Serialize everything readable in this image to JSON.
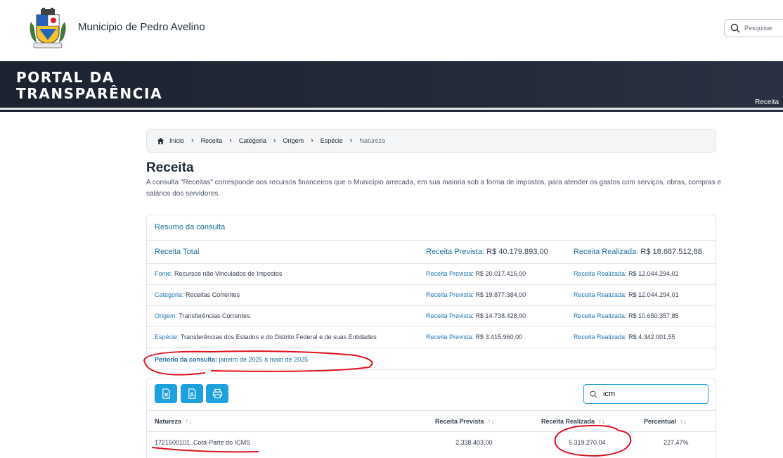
{
  "header": {
    "municipality": "Municipio de Pedro Avelino",
    "search_placeholder": "Pesquisar"
  },
  "banner": {
    "title_line1": "PORTAL DA",
    "title_line2": "TRANSPARÊNCIA",
    "active_tab": "Receita"
  },
  "breadcrumb": {
    "items": [
      "Inicio",
      "Receita",
      "Categoria",
      "Origem",
      "Espécie",
      "Natureza"
    ]
  },
  "page": {
    "title": "Receita",
    "description": "A consulta \"Receitas\" corresponde aos recursos financeiros que o Município arrecada, em sua maioria sob a forma de impostos, para atender os gastos com serviços, obras, compras e salários dos servidores."
  },
  "summary": {
    "heading": "Resumo da consulta",
    "total": {
      "label": "Receita Total",
      "prevista_label": "Receita Prevista:",
      "prevista_value": "R$ 40.179.893,00",
      "realizada_label": "Receita Realizada:",
      "realizada_value": "R$ 18.687.512,88"
    },
    "rows": [
      {
        "label": "Fonte:",
        "value": "Recursos não Vinculados de Impostos",
        "prevista_label": "Receita Prevista:",
        "prevista_value": "R$ 20.017.415,00",
        "realizada_label": "Receita Realizada:",
        "realizada_value": "R$ 12.044.294,01"
      },
      {
        "label": "Categoria:",
        "value": "Receitas Correntes",
        "prevista_label": "Receita Prevista:",
        "prevista_value": "R$ 19.877.384,00",
        "realizada_label": "Receita Realizada:",
        "realizada_value": "R$ 12.044.294,01"
      },
      {
        "label": "Origem:",
        "value": "Transferências Correntes",
        "prevista_label": "Receita Prevista:",
        "prevista_value": "R$ 14.738.428,00",
        "realizada_label": "Receita Realizada:",
        "realizada_value": "R$ 10.650.357,85"
      },
      {
        "label": "Espécie:",
        "value": "Transferências dos Estados e do Distrito Federal e de suas Entidades",
        "prevista_label": "Receita Prevista:",
        "prevista_value": "R$ 3.415.960,00",
        "realizada_label": "Receita Realizada:",
        "realizada_value": "R$ 4.342.001,55"
      }
    ],
    "period_label": "Período da consulta:",
    "period_value": "janeiro de 2025 à maio de 2025"
  },
  "toolbar": {
    "search_value": "icm"
  },
  "table": {
    "headers": [
      "Natureza",
      "Receita Prevista",
      "Receita Realizada",
      "Percentual"
    ],
    "sort_glyph": "↑↓",
    "rows": [
      {
        "natureza": "1721500101. Cota-Parte do ICMS",
        "prevista": "2.338.403,00",
        "realizada": "5.319.270,04",
        "percentual": "227,47%"
      }
    ]
  },
  "colors": {
    "banner": "#1c2230",
    "accent": "#1da1dc",
    "link": "#1f77b4",
    "annotation": "#e0101e"
  },
  "icons": [
    "search-icon",
    "home-icon",
    "chevron-right-icon",
    "excel-icon",
    "pdf-icon",
    "print-icon"
  ]
}
